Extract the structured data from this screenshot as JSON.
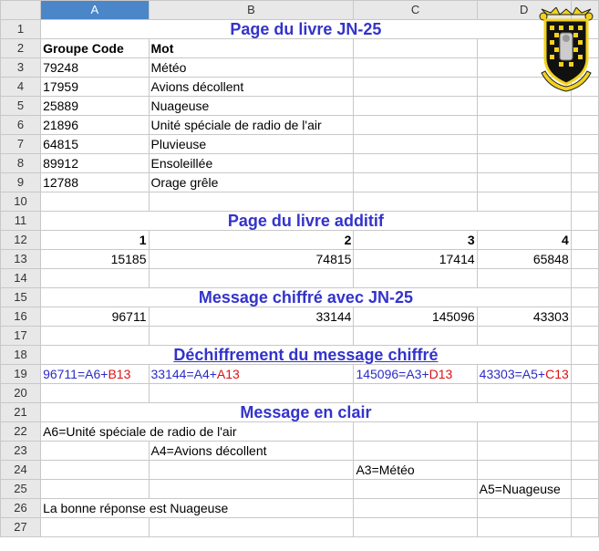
{
  "columns": [
    "A",
    "B",
    "C",
    "D"
  ],
  "rows": [
    "1",
    "2",
    "3",
    "4",
    "5",
    "6",
    "7",
    "8",
    "9",
    "10",
    "11",
    "12",
    "13",
    "14",
    "15",
    "16",
    "17",
    "18",
    "19",
    "20",
    "21",
    "22",
    "23",
    "24",
    "25",
    "26",
    "27"
  ],
  "titles": {
    "jn25_page": "Page du livre JN-25",
    "additive_page": "Page du livre additif",
    "encrypted_msg": "Message chiffré avec JN-25",
    "decryption": "Déchiffrement du message chiffré",
    "plaintext": "Message en clair"
  },
  "codebook": {
    "header_code": "Groupe Code",
    "header_word": "Mot",
    "entries": [
      {
        "code": "79248",
        "word": "Météo"
      },
      {
        "code": "17959",
        "word": "Avions décollent"
      },
      {
        "code": "25889",
        "word": "Nuageuse"
      },
      {
        "code": "21896",
        "word": "Unité spéciale de radio de l'air"
      },
      {
        "code": "64815",
        "word": "Pluvieuse"
      },
      {
        "code": "89912",
        "word": "Ensoleillée"
      },
      {
        "code": "12788",
        "word": "Orage grêle"
      }
    ]
  },
  "additive": {
    "indices": [
      "1",
      "2",
      "3",
      "4"
    ],
    "values": [
      "15185",
      "74815",
      "17414",
      "65848"
    ]
  },
  "encrypted": [
    "96711",
    "33144",
    "145096",
    "43303"
  ],
  "decryption": [
    {
      "lhs": "96711=A6+",
      "ref": "B13"
    },
    {
      "lhs": "33144=A4+",
      "ref": "A13"
    },
    {
      "lhs": "145096=A3+",
      "ref": "D13"
    },
    {
      "lhs": "43303=A5+",
      "ref": "C13"
    }
  ],
  "clear": {
    "r22": "A6=Unité spéciale de radio de l'air",
    "r23": "A4=Avions décollent",
    "r24": "A3=Météo",
    "r25": "A5=Nuageuse",
    "r26": "La bonne réponse est Nuageuse"
  }
}
